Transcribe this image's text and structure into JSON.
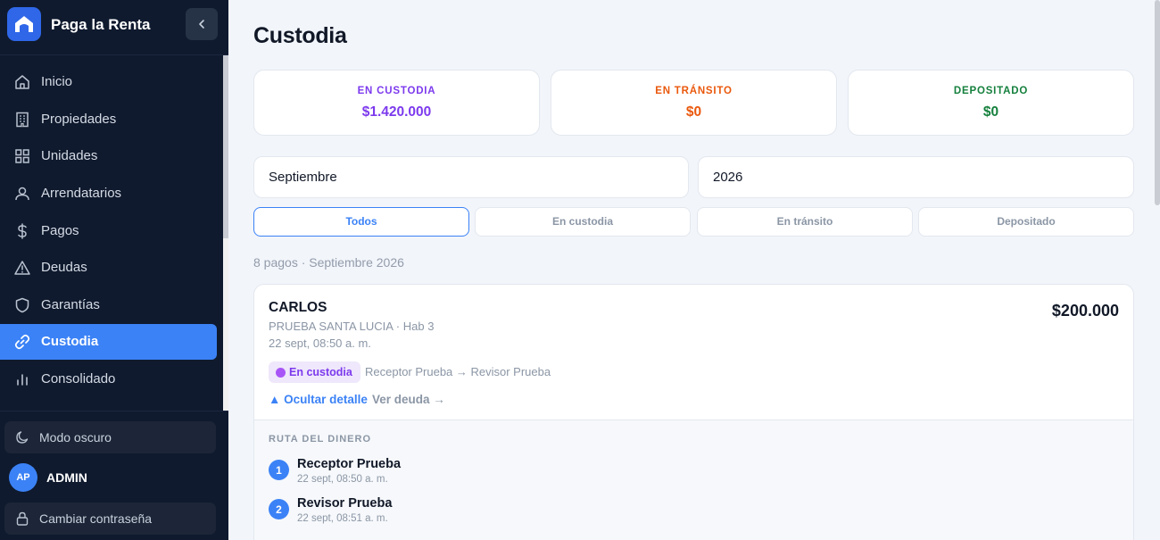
{
  "brand": {
    "name": "Paga la Renta"
  },
  "sidebar": {
    "items": [
      {
        "label": "Inicio",
        "icon": "home-icon"
      },
      {
        "label": "Propiedades",
        "icon": "building-icon"
      },
      {
        "label": "Unidades",
        "icon": "grid-icon"
      },
      {
        "label": "Arrendatarios",
        "icon": "person-icon"
      },
      {
        "label": "Pagos",
        "icon": "dollar-icon"
      },
      {
        "label": "Deudas",
        "icon": "warning-icon"
      },
      {
        "label": "Garantías",
        "icon": "shield-icon"
      },
      {
        "label": "Custodia",
        "icon": "link-icon",
        "active": true
      },
      {
        "label": "Consolidado",
        "icon": "bar-chart-icon"
      }
    ],
    "dark_mode_label": "Modo oscuro",
    "user": {
      "initials": "AP",
      "name": "ADMIN"
    },
    "change_password_label": "Cambiar contraseña"
  },
  "main": {
    "title": "Custodia",
    "stats": [
      {
        "label": "EN CUSTODIA",
        "value": "$1.420.000",
        "color": "#7c3aed"
      },
      {
        "label": "EN TRÁNSITO",
        "value": "$0",
        "color": "#ea580c"
      },
      {
        "label": "DEPOSITADO",
        "value": "$0",
        "color": "#15803d"
      }
    ],
    "filters": {
      "month": "Septiembre",
      "year": "2026"
    },
    "tabs": [
      {
        "label": "Todos",
        "active": true
      },
      {
        "label": "En custodia"
      },
      {
        "label": "En tránsito"
      },
      {
        "label": "Depositado"
      }
    ],
    "count_text": "8 pagos · Septiembre 2026",
    "payment": {
      "tenant": "CARLOS",
      "amount": "$200.000",
      "property": "PRUEBA SANTA LUCIA · Hab 3",
      "date": "22 sept, 08:50 a. m.",
      "status": "En custodia",
      "route": "Receptor Prueba → Revisor Prueba",
      "hide_detail": "▲ Ocultar detalle",
      "view_debt": "Ver deuda →",
      "detail_title": "RUTA DEL DINERO",
      "steps": [
        {
          "num": "1",
          "name": "Receptor Prueba",
          "time": "22 sept, 08:50 a. m."
        },
        {
          "num": "2",
          "name": "Revisor Prueba",
          "time": "22 sept, 08:51 a. m."
        }
      ]
    }
  }
}
